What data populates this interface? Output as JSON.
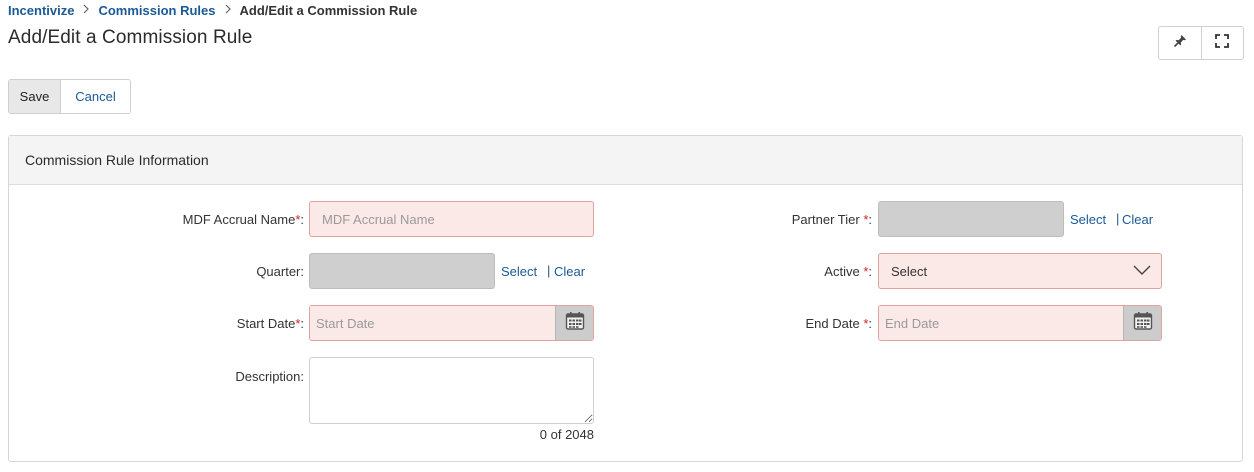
{
  "breadcrumb": {
    "items": [
      "Incentivize",
      "Commission Rules"
    ],
    "current": "Add/Edit a Commission Rule"
  },
  "page": {
    "title": "Add/Edit a Commission Rule"
  },
  "toolbar": {
    "save_label": "Save",
    "cancel_label": "Cancel"
  },
  "header_icons": [
    "pin-icon",
    "fullscreen-icon"
  ],
  "panel": {
    "title": "Commission Rule Information"
  },
  "form": {
    "mdf_accrual_name": {
      "label": "MDF Accrual Name",
      "placeholder": "MDF Accrual Name",
      "required": true
    },
    "quarter": {
      "label": "Quarter:",
      "select": "Select",
      "clear": "Clear"
    },
    "start_date": {
      "label": "Start Date",
      "placeholder": "Start Date",
      "required": true
    },
    "description": {
      "label": "Description:",
      "counter": "0 of 2048"
    },
    "partner_tier": {
      "label": "Partner Tier",
      "select": "Select",
      "clear": "Clear",
      "required": true
    },
    "active": {
      "label": "Active",
      "value": "Select",
      "required": true
    },
    "end_date": {
      "label": "End Date",
      "placeholder": "End Date",
      "required": true
    }
  },
  "colors": {
    "link": "#1a5a96",
    "required_bg": "#fbe9e7",
    "required_border": "#e0a29c",
    "required_star": "#c62828",
    "lookup_bg": "#cfcfcf"
  }
}
